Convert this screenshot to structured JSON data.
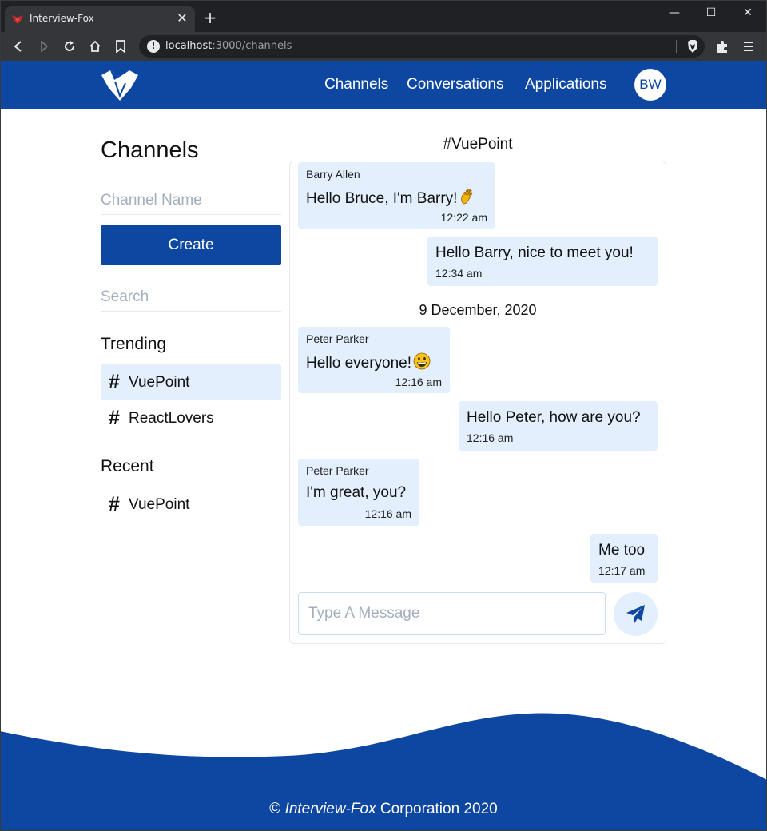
{
  "browser": {
    "tab_title": "Interview-Fox",
    "tab_close": "✕",
    "new_tab": "+",
    "url_host": "localhost",
    "url_rest": ":3000/channels",
    "window_controls": [
      "—",
      "☐",
      "✕"
    ]
  },
  "header": {
    "nav": [
      "Channels",
      "Conversations",
      "Applications"
    ],
    "avatar_initials": "BW"
  },
  "sidebar": {
    "title": "Channels",
    "channel_name_placeholder": "Channel Name",
    "create_label": "Create",
    "search_placeholder": "Search",
    "trending_label": "Trending",
    "trending": [
      {
        "hash": "#",
        "name": "VuePoint"
      },
      {
        "hash": "#",
        "name": "ReactLovers"
      }
    ],
    "recent_label": "Recent",
    "recent": [
      {
        "hash": "#",
        "name": "VuePoint"
      }
    ]
  },
  "chat": {
    "title": "#VuePoint",
    "date_separator": "9 December, 2020",
    "messages": [
      {
        "author": "Barry Allen",
        "text": "Hello Bruce, I'm Barry!",
        "emoji": "waving-hand-icon",
        "time": "12:22 am",
        "direction": "incoming"
      },
      {
        "author": "",
        "text": "Hello Barry, nice to meet you!",
        "time": "12:34 am",
        "direction": "outgoing"
      },
      {
        "author": "Peter Parker",
        "text": "Hello everyone!",
        "emoji": "grinning-face-icon",
        "time": "12:16 am",
        "direction": "incoming"
      },
      {
        "author": "",
        "text": "Hello Peter, how are you?",
        "time": "12:16 am",
        "direction": "outgoing"
      },
      {
        "author": "Peter Parker",
        "text": "I'm great, you?",
        "time": "12:16 am",
        "direction": "incoming"
      },
      {
        "author": "",
        "text": "Me too",
        "time": "12:17 am",
        "direction": "outgoing"
      }
    ],
    "input_placeholder": "Type A Message"
  },
  "footer": {
    "copyright": "©",
    "brand": "Interview-Fox",
    "suffix": "Corporation 2020"
  },
  "colors": {
    "brand_blue": "#0e47a1",
    "bubble": "#e3effd",
    "placeholder": "#a3aebf"
  }
}
